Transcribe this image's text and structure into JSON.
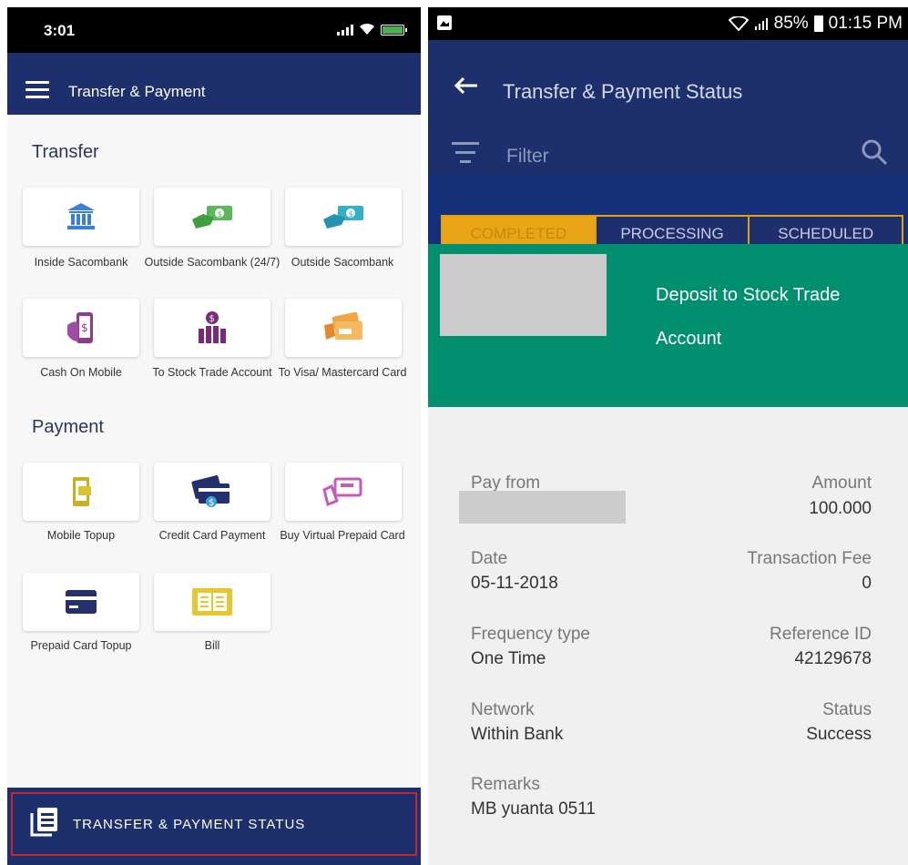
{
  "left_phone": {
    "status_bar": {
      "time": "3:01"
    },
    "app_bar": {
      "title": "Transfer & Payment"
    },
    "transfer_section": {
      "title": "Transfer",
      "items": [
        {
          "label": "Inside Sacombank",
          "icon": "bank-icon"
        },
        {
          "label": "Outside Sacombank (24/7)",
          "icon": "cash-transfer-icon"
        },
        {
          "label": "Outside Sacombank",
          "icon": "cash-transfer-icon"
        },
        {
          "label": "Cash On Mobile",
          "icon": "mobile-cash-icon"
        },
        {
          "label": "To Stock Trade Account",
          "icon": "stock-chart-icon"
        },
        {
          "label": "To Visa/ Mastercard Card",
          "icon": "card-hand-icon"
        }
      ]
    },
    "payment_section": {
      "title": "Payment",
      "items": [
        {
          "label": "Mobile Topup",
          "icon": "mobile-topup-icon"
        },
        {
          "label": "Credit Card Payment",
          "icon": "credit-card-pay-icon"
        },
        {
          "label": "Buy Virtual Prepaid Card",
          "icon": "virtual-card-icon"
        },
        {
          "label": "Prepaid Card Topup",
          "icon": "prepaid-card-icon"
        },
        {
          "label": "Bill",
          "icon": "bill-icon"
        }
      ]
    },
    "status_button": {
      "label": "TRANSFER & PAYMENT STATUS"
    },
    "colors": {
      "navy": "#1e2f6e",
      "accent_red": "#c62828"
    }
  },
  "right_phone": {
    "status_bar": {
      "battery": "85%",
      "time": "01:15 PM"
    },
    "app_bar": {
      "title": "Transfer & Payment Status",
      "filter_placeholder": "Filter"
    },
    "tabs": [
      {
        "label": "COMPLETED",
        "active": true
      },
      {
        "label": "PROCESSING",
        "active": false
      },
      {
        "label": "SCHEDULED",
        "active": false
      }
    ],
    "card": {
      "description_line1": "Deposit to Stock Trade",
      "description_line2": "Account"
    },
    "details": {
      "pay_from_label": "Pay from",
      "amount_label": "Amount",
      "amount_value": "100.000",
      "date_label": "Date",
      "date_value": "05-11-2018",
      "fee_label": "Transaction Fee",
      "fee_value": "0",
      "frequency_label": "Frequency type",
      "frequency_value": "One Time",
      "reference_label": "Reference ID",
      "reference_value": "42129678",
      "network_label": "Network",
      "network_value": "Within Bank",
      "status_label": "Status",
      "status_value": "Success",
      "remarks_label": "Remarks",
      "remarks_value": "MB yuanta 0511"
    },
    "colors": {
      "green": "#00906f",
      "tab_gold": "#e8a516"
    }
  }
}
